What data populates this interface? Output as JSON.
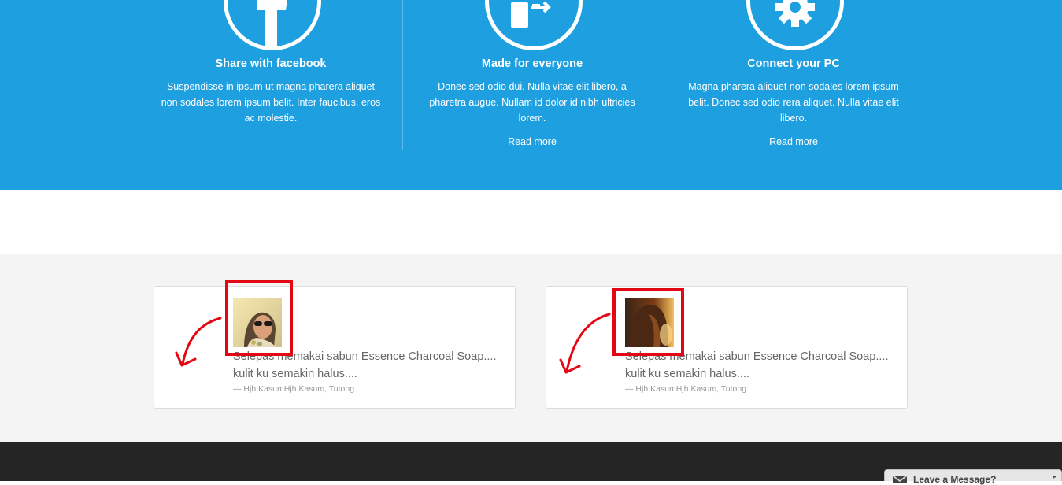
{
  "features": [
    {
      "icon": "facebook-icon",
      "title": "Share with facebook",
      "text": "Suspendisse in ipsum ut magna pharera aliquet non sodales lorem ipsum belit. Inter faucibus, eros ac molestie."
    },
    {
      "icon": "device-share-icon",
      "title": "Made for everyone",
      "text": "Donec sed odio dui. Nulla vitae elit libero, a pharetra augue. Nullam id dolor id nibh ultricies lorem.",
      "link": "Read more"
    },
    {
      "icon": "gear-icon",
      "title": "Connect your PC",
      "text": "Magna pharera aliquet non sodales lorem ipsum belit. Donec sed odio rera aliquet. Nulla vitae elit libero.",
      "link": "Read more"
    }
  ],
  "testimonials": [
    {
      "quote": "Selepas memakai sabun Essence Charcoal Soap.... kulit ku semakin halus....",
      "author": "— Hjh KasumHjh Kasum, Tutong"
    },
    {
      "quote": "Selepas memakai sabun Essence Charcoal Soap.... kulit ku semakin halus....",
      "author": "— Hjh KasumHjh Kasum, Tutong"
    }
  ],
  "chat_widget": {
    "label": "Leave a Message?"
  },
  "colors": {
    "hero_blue": "#1e9fe0",
    "annotation_red": "#e30613",
    "footer_dark": "#252525"
  }
}
